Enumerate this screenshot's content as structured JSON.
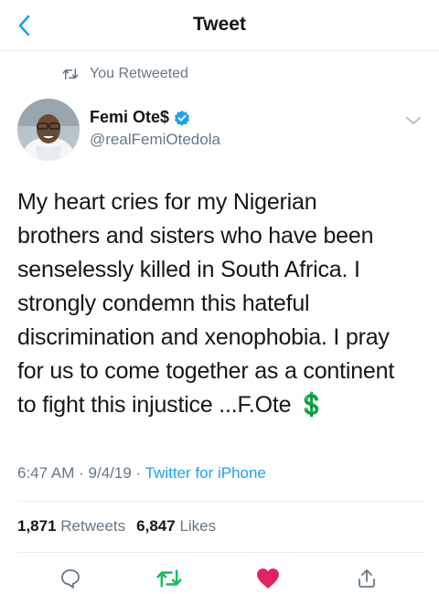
{
  "header": {
    "title": "Tweet",
    "back_icon": "chevron-left-icon"
  },
  "retweet_notice": {
    "label": "You Retweeted",
    "icon": "retweet-icon"
  },
  "author": {
    "name": "Femi Ote$",
    "handle": "@realFemiOtedola",
    "verified": true
  },
  "tweet": {
    "lines": [
      "My heart cries for my Nigerian",
      "brothers and sisters who have been",
      "senselessly killed in South Africa. I",
      "strongly condemn this hateful",
      "discrimination and xenophobia. I pray",
      "for us to come together as a continent",
      "to fight this injustice ...F.Ote"
    ],
    "emoji": "💲"
  },
  "meta": {
    "time": "6:47 AM",
    "separator": "·",
    "date": "9/4/19",
    "source": "Twitter for iPhone"
  },
  "stats": {
    "retweets_count": "1,871",
    "retweets_label": "Retweets",
    "likes_count": "6,847",
    "likes_label": "Likes"
  },
  "actions": {
    "reply_icon": "reply-icon",
    "retweet_icon": "retweet-icon",
    "like_icon": "heart-icon",
    "share_icon": "share-icon"
  },
  "colors": {
    "accent": "#1da1f2",
    "retweet_active": "#17bf63",
    "like_active": "#e0245e",
    "secondary_text": "#657786"
  }
}
